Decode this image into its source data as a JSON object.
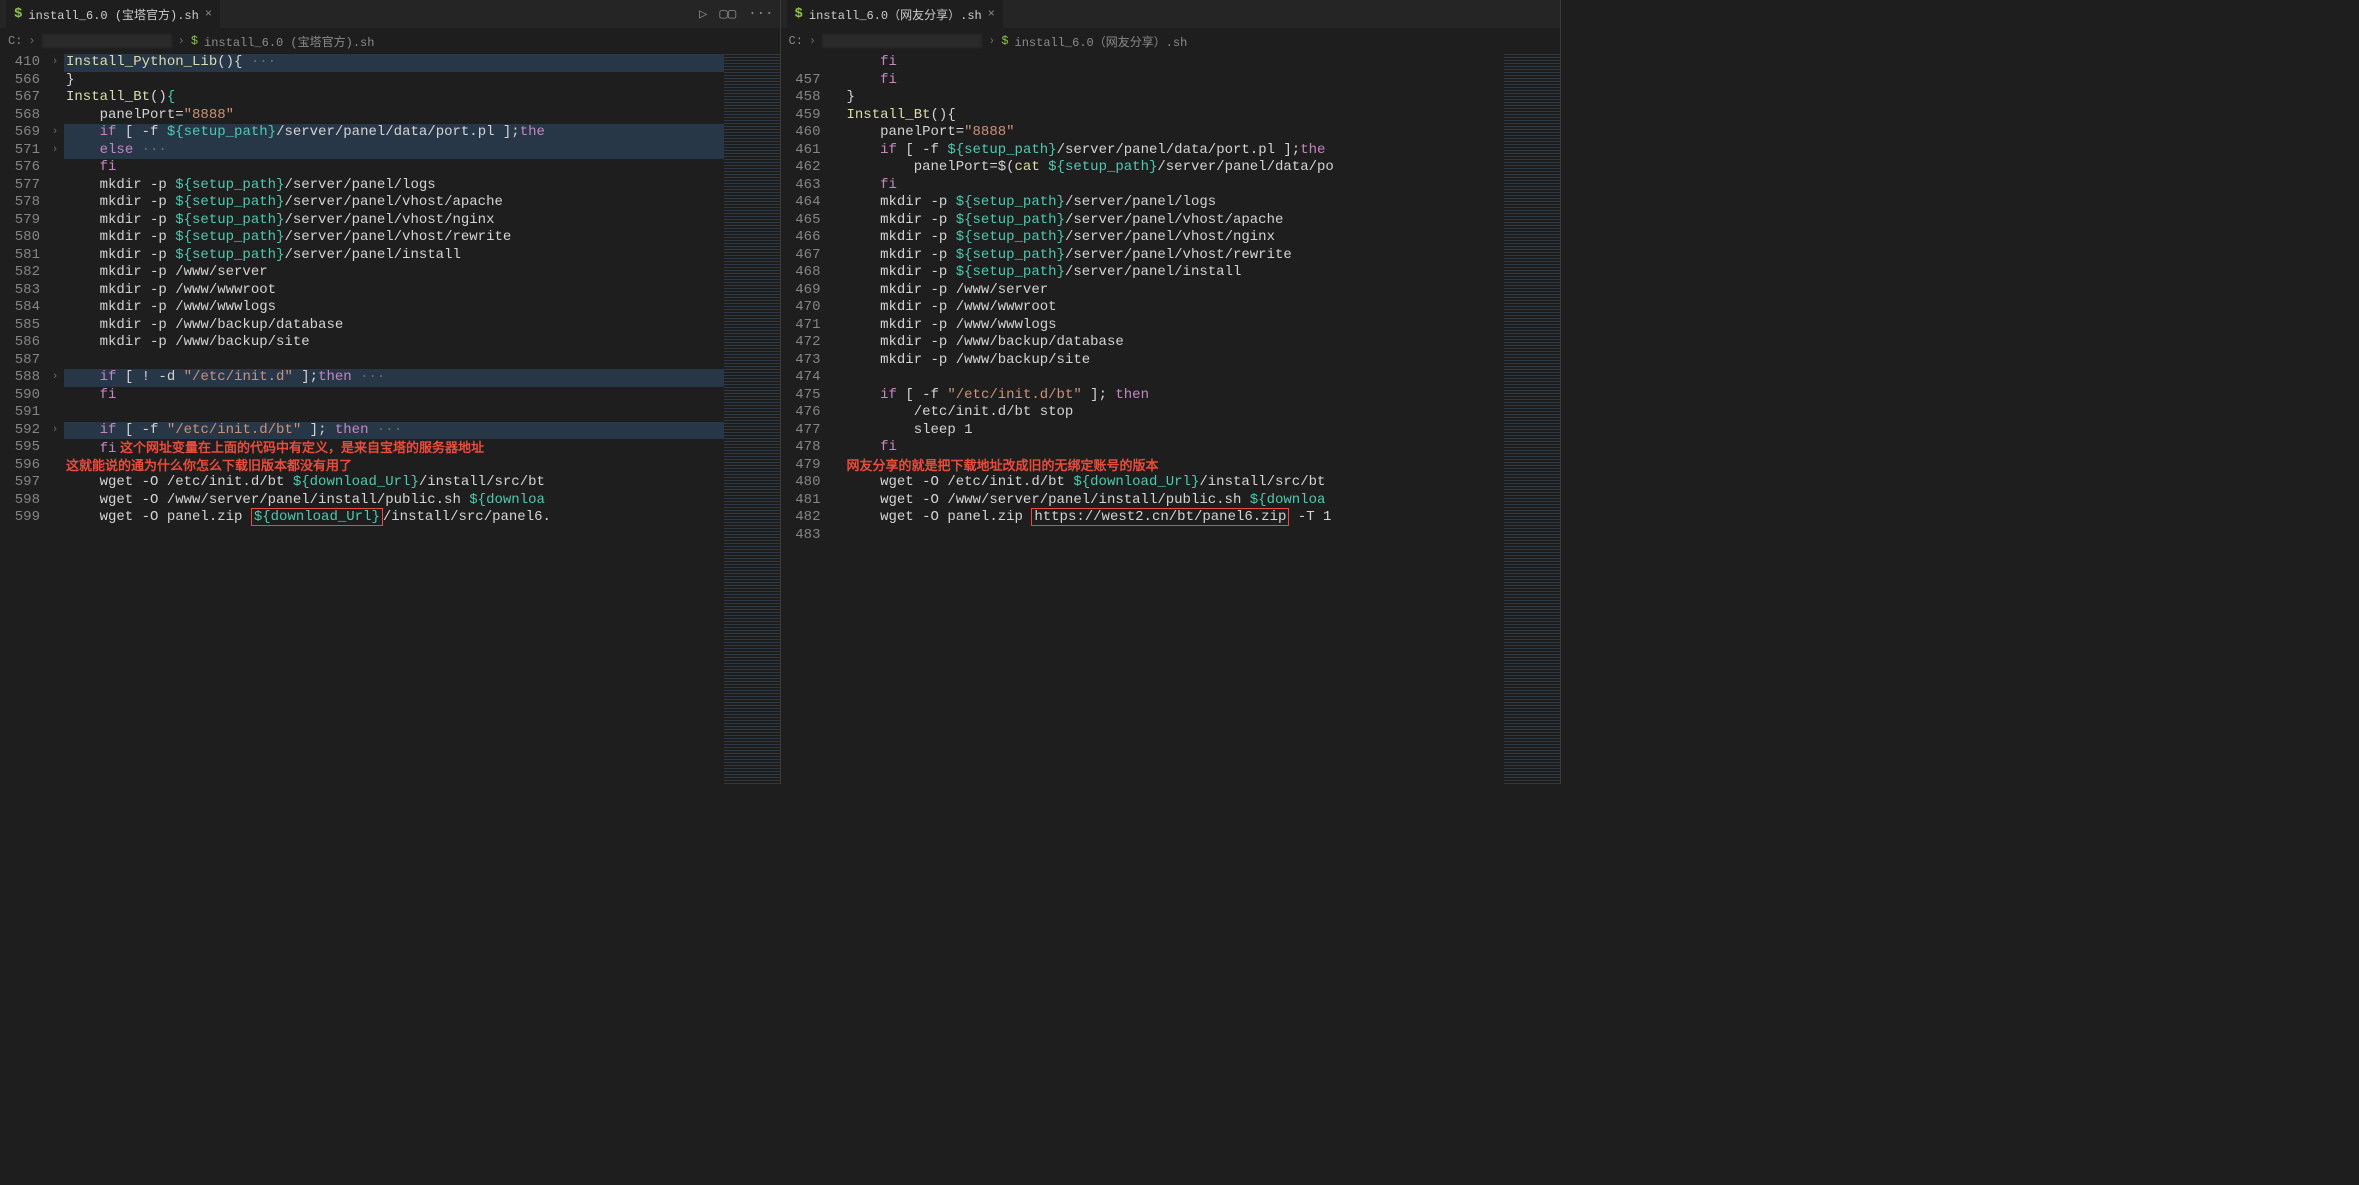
{
  "left": {
    "tab": {
      "icon": "$",
      "label": "install_6.0 (宝塔官方).sh",
      "close": "×"
    },
    "actions": {
      "run": "▷",
      "split": "▢▢",
      "more": "···"
    },
    "breadcrumb": {
      "drive": "C:",
      "sep": "›",
      "icon": "$",
      "file": "install_6.0 (宝塔官方).sh"
    },
    "lines": [
      {
        "n": "410",
        "fold": "›",
        "hl": true,
        "segs": [
          {
            "t": "Install_Python_Lib",
            "c": "fn"
          },
          {
            "t": "(){",
            "c": "plain"
          },
          {
            "t": " ···",
            "c": "dots"
          }
        ]
      },
      {
        "n": "566",
        "segs": [
          {
            "t": "}",
            "c": "plain"
          }
        ]
      },
      {
        "n": "567",
        "segs": [
          {
            "t": "Install_Bt",
            "c": "fn"
          },
          {
            "t": "()",
            "c": "plain"
          },
          {
            "t": "{",
            "c": "brace"
          },
          {
            "t": "",
            "c": "plain"
          }
        ]
      },
      {
        "n": "568",
        "segs": [
          {
            "t": "    panelPort=",
            "c": "plain"
          },
          {
            "t": "\"8888\"",
            "c": "str"
          }
        ]
      },
      {
        "n": "569",
        "fold": "›",
        "hl": true,
        "segs": [
          {
            "t": "    ",
            "c": "plain"
          },
          {
            "t": "if",
            "c": "kw"
          },
          {
            "t": " [ -f ",
            "c": "plain"
          },
          {
            "t": "${setup_path}",
            "c": "var"
          },
          {
            "t": "/server/panel/data/port.pl ];",
            "c": "plain"
          },
          {
            "t": "the",
            "c": "kw"
          }
        ]
      },
      {
        "n": "571",
        "fold": "›",
        "hl": true,
        "segs": [
          {
            "t": "    ",
            "c": "plain"
          },
          {
            "t": "else",
            "c": "kw"
          },
          {
            "t": " ···",
            "c": "dots"
          }
        ]
      },
      {
        "n": "576",
        "segs": [
          {
            "t": "    ",
            "c": "plain"
          },
          {
            "t": "fi",
            "c": "kw"
          }
        ]
      },
      {
        "n": "577",
        "segs": [
          {
            "t": "    mkdir -p ",
            "c": "plain"
          },
          {
            "t": "${setup_path}",
            "c": "var"
          },
          {
            "t": "/server/panel/logs",
            "c": "plain"
          }
        ]
      },
      {
        "n": "578",
        "segs": [
          {
            "t": "    mkdir -p ",
            "c": "plain"
          },
          {
            "t": "${setup_path}",
            "c": "var"
          },
          {
            "t": "/server/panel/vhost/apache",
            "c": "plain"
          }
        ]
      },
      {
        "n": "579",
        "segs": [
          {
            "t": "    mkdir -p ",
            "c": "plain"
          },
          {
            "t": "${setup_path}",
            "c": "var"
          },
          {
            "t": "/server/panel/vhost/nginx",
            "c": "plain"
          }
        ]
      },
      {
        "n": "580",
        "segs": [
          {
            "t": "    mkdir -p ",
            "c": "plain"
          },
          {
            "t": "${setup_path}",
            "c": "var"
          },
          {
            "t": "/server/panel/vhost/rewrite",
            "c": "plain"
          }
        ]
      },
      {
        "n": "581",
        "segs": [
          {
            "t": "    mkdir -p ",
            "c": "plain"
          },
          {
            "t": "${setup_path}",
            "c": "var"
          },
          {
            "t": "/server/panel/install",
            "c": "plain"
          }
        ]
      },
      {
        "n": "582",
        "segs": [
          {
            "t": "    mkdir -p /www/server",
            "c": "plain"
          }
        ]
      },
      {
        "n": "583",
        "segs": [
          {
            "t": "    mkdir -p /www/wwwroot",
            "c": "plain"
          }
        ]
      },
      {
        "n": "584",
        "segs": [
          {
            "t": "    mkdir -p /www/wwwlogs",
            "c": "plain"
          }
        ]
      },
      {
        "n": "585",
        "segs": [
          {
            "t": "    mkdir -p /www/backup/database",
            "c": "plain"
          }
        ]
      },
      {
        "n": "586",
        "segs": [
          {
            "t": "    mkdir -p /www/backup/site",
            "c": "plain"
          }
        ]
      },
      {
        "n": "587",
        "segs": [
          {
            "t": "",
            "c": "plain"
          }
        ]
      },
      {
        "n": "588",
        "fold": "›",
        "hl": true,
        "segs": [
          {
            "t": "    ",
            "c": "plain"
          },
          {
            "t": "if",
            "c": "kw"
          },
          {
            "t": " [ ! -d ",
            "c": "plain"
          },
          {
            "t": "\"/etc/init.d\"",
            "c": "str"
          },
          {
            "t": " ];",
            "c": "plain"
          },
          {
            "t": "then",
            "c": "kw"
          },
          {
            "t": " ···",
            "c": "dots"
          }
        ]
      },
      {
        "n": "590",
        "segs": [
          {
            "t": "    ",
            "c": "plain"
          },
          {
            "t": "fi",
            "c": "kw"
          }
        ]
      },
      {
        "n": "591",
        "segs": [
          {
            "t": "",
            "c": "plain"
          }
        ]
      },
      {
        "n": "592",
        "fold": "›",
        "hl": true,
        "segs": [
          {
            "t": "    ",
            "c": "plain"
          },
          {
            "t": "if",
            "c": "kw"
          },
          {
            "t": " [ -f ",
            "c": "plain"
          },
          {
            "t": "\"/etc/init.d/bt\"",
            "c": "str"
          },
          {
            "t": " ]; ",
            "c": "plain"
          },
          {
            "t": "then",
            "c": "kw"
          },
          {
            "t": " ···",
            "c": "dots"
          }
        ]
      },
      {
        "n": "595",
        "annot1": "这个网址变量在上面的代码中有定义，是来自宝塔的服务器地址",
        "segs": [
          {
            "t": "    ",
            "c": "plain"
          },
          {
            "t": "fi",
            "c": "kw"
          }
        ]
      },
      {
        "n": "596",
        "annot2": "这就能说的通为什么你怎么下载旧版本都没有用了",
        "segs": [
          {
            "t": "",
            "c": "plain"
          }
        ]
      },
      {
        "n": "597",
        "segs": [
          {
            "t": "    wget -O /etc/init.d/bt ",
            "c": "plain"
          },
          {
            "t": "${download_Url}",
            "c": "var"
          },
          {
            "t": "/install/src/bt",
            "c": "plain"
          }
        ]
      },
      {
        "n": "598",
        "segs": [
          {
            "t": "    wget -O /www/server/panel/install/public.sh ",
            "c": "plain"
          },
          {
            "t": "${downloa",
            "c": "var"
          }
        ]
      },
      {
        "n": "599",
        "box": "${download_Url}",
        "segs": [
          {
            "t": "    wget -O panel.zip ",
            "c": "plain"
          },
          {
            "t": "${download_Url}",
            "c": "var",
            "box": true
          },
          {
            "t": "/install/src/panel6.",
            "c": "plain"
          }
        ]
      }
    ]
  },
  "right": {
    "tab": {
      "icon": "$",
      "label": "install_6.0（网友分享）.sh",
      "close": "×"
    },
    "breadcrumb": {
      "drive": "C:",
      "sep": "›",
      "icon": "$",
      "file": "install_6.0（网友分享）.sh"
    },
    "lines": [
      {
        "n": " ",
        "segs": [
          {
            "t": "    ",
            "c": "plain"
          },
          {
            "t": "fi",
            "c": "kw"
          }
        ]
      },
      {
        "n": "457",
        "segs": [
          {
            "t": "    ",
            "c": "plain"
          },
          {
            "t": "fi",
            "c": "kw"
          }
        ]
      },
      {
        "n": "458",
        "segs": [
          {
            "t": "}",
            "c": "plain"
          }
        ]
      },
      {
        "n": "459",
        "segs": [
          {
            "t": "Install_Bt",
            "c": "fn"
          },
          {
            "t": "(){",
            "c": "plain"
          }
        ]
      },
      {
        "n": "460",
        "segs": [
          {
            "t": "    panelPort=",
            "c": "plain"
          },
          {
            "t": "\"8888\"",
            "c": "str"
          }
        ]
      },
      {
        "n": "461",
        "segs": [
          {
            "t": "    ",
            "c": "plain"
          },
          {
            "t": "if",
            "c": "kw"
          },
          {
            "t": " [ -f ",
            "c": "plain"
          },
          {
            "t": "${setup_path}",
            "c": "var"
          },
          {
            "t": "/server/panel/data/port.pl ];",
            "c": "plain"
          },
          {
            "t": "the",
            "c": "kw"
          }
        ]
      },
      {
        "n": "462",
        "segs": [
          {
            "t": "        panelPort=$(",
            "c": "plain"
          },
          {
            "t": "cat",
            "c": "fn"
          },
          {
            "t": " ",
            "c": "plain"
          },
          {
            "t": "${setup_path}",
            "c": "var"
          },
          {
            "t": "/server/panel/data/po",
            "c": "plain"
          }
        ]
      },
      {
        "n": "463",
        "segs": [
          {
            "t": "    ",
            "c": "plain"
          },
          {
            "t": "fi",
            "c": "kw"
          }
        ]
      },
      {
        "n": "464",
        "segs": [
          {
            "t": "    mkdir -p ",
            "c": "plain"
          },
          {
            "t": "${setup_path}",
            "c": "var"
          },
          {
            "t": "/server/panel/logs",
            "c": "plain"
          }
        ]
      },
      {
        "n": "465",
        "segs": [
          {
            "t": "    mkdir -p ",
            "c": "plain"
          },
          {
            "t": "${setup_path}",
            "c": "var"
          },
          {
            "t": "/server/panel/vhost/apache",
            "c": "plain"
          }
        ]
      },
      {
        "n": "466",
        "segs": [
          {
            "t": "    mkdir -p ",
            "c": "plain"
          },
          {
            "t": "${setup_path}",
            "c": "var"
          },
          {
            "t": "/server/panel/vhost/nginx",
            "c": "plain"
          }
        ]
      },
      {
        "n": "467",
        "segs": [
          {
            "t": "    mkdir -p ",
            "c": "plain"
          },
          {
            "t": "${setup_path}",
            "c": "var"
          },
          {
            "t": "/server/panel/vhost/rewrite",
            "c": "plain"
          }
        ]
      },
      {
        "n": "468",
        "segs": [
          {
            "t": "    mkdir -p ",
            "c": "plain"
          },
          {
            "t": "${setup_path}",
            "c": "var"
          },
          {
            "t": "/server/panel/install",
            "c": "plain"
          }
        ]
      },
      {
        "n": "469",
        "segs": [
          {
            "t": "    mkdir -p /www/server",
            "c": "plain"
          }
        ]
      },
      {
        "n": "470",
        "segs": [
          {
            "t": "    mkdir -p /www/wwwroot",
            "c": "plain"
          }
        ]
      },
      {
        "n": "471",
        "segs": [
          {
            "t": "    mkdir -p /www/wwwlogs",
            "c": "plain"
          }
        ]
      },
      {
        "n": "472",
        "segs": [
          {
            "t": "    mkdir -p /www/backup/database",
            "c": "plain"
          }
        ]
      },
      {
        "n": "473",
        "segs": [
          {
            "t": "    mkdir -p /www/backup/site",
            "c": "plain"
          }
        ]
      },
      {
        "n": "474",
        "segs": [
          {
            "t": "",
            "c": "plain"
          }
        ]
      },
      {
        "n": "475",
        "segs": [
          {
            "t": "    ",
            "c": "plain"
          },
          {
            "t": "if",
            "c": "kw"
          },
          {
            "t": " [ -f ",
            "c": "plain"
          },
          {
            "t": "\"/etc/init.d/bt\"",
            "c": "str"
          },
          {
            "t": " ]; ",
            "c": "plain"
          },
          {
            "t": "then",
            "c": "kw"
          }
        ]
      },
      {
        "n": "476",
        "segs": [
          {
            "t": "        /etc/init.d/bt stop",
            "c": "plain"
          }
        ]
      },
      {
        "n": "477",
        "segs": [
          {
            "t": "        sleep 1",
            "c": "plain"
          }
        ]
      },
      {
        "n": "478",
        "segs": [
          {
            "t": "    ",
            "c": "plain"
          },
          {
            "t": "fi",
            "c": "kw"
          }
        ]
      },
      {
        "n": "479",
        "annot1": "网友分享的就是把下载地址改成旧的无绑定账号的版本",
        "segs": [
          {
            "t": "",
            "c": "plain"
          }
        ]
      },
      {
        "n": "480",
        "segs": [
          {
            "t": "    wget -O /etc/init.d/bt ",
            "c": "plain"
          },
          {
            "t": "${download_Url}",
            "c": "var"
          },
          {
            "t": "/install/src/bt",
            "c": "plain"
          }
        ]
      },
      {
        "n": "481",
        "segs": [
          {
            "t": "    wget -O /www/server/panel/install/public.sh ",
            "c": "plain"
          },
          {
            "t": "${downloa",
            "c": "var"
          }
        ]
      },
      {
        "n": "482",
        "segs": [
          {
            "t": "    wget -O panel.zip ",
            "c": "plain"
          },
          {
            "t": "https://west2.cn/bt/panel6.zip",
            "c": "plain",
            "box": true
          },
          {
            "t": " -T 1",
            "c": "plain"
          }
        ]
      },
      {
        "n": "483",
        "segs": [
          {
            "t": "",
            "c": "plain"
          }
        ]
      }
    ]
  }
}
